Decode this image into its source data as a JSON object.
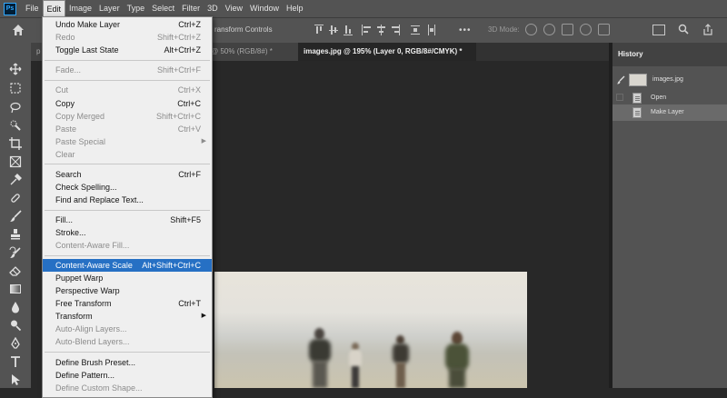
{
  "app": {
    "logo": "Ps",
    "menubar": [
      "File",
      "Edit",
      "Image",
      "Layer",
      "Type",
      "Select",
      "Filter",
      "3D",
      "View",
      "Window",
      "Help"
    ],
    "active_menu": "Edit"
  },
  "options_bar": {
    "transform_controls": "ransform Controls",
    "mode_3d": "3D Mode:"
  },
  "tabs": [
    {
      "label": "p",
      "label_visible": "g @ 50% (RGB/8#) *"
    },
    {
      "label": "images.jpg @ 195% (Layer 0, RGB/8#/CMYK) *"
    }
  ],
  "history": {
    "title": "History",
    "snapshot": "images.jpg",
    "items": [
      {
        "label": "Open"
      },
      {
        "label": "Make Layer",
        "selected": true
      }
    ]
  },
  "edit_menu": {
    "items": [
      {
        "label": "Undo Make Layer",
        "shortcut": "Ctrl+Z"
      },
      {
        "label": "Redo",
        "shortcut": "Shift+Ctrl+Z",
        "disabled": true
      },
      {
        "label": "Toggle Last State",
        "shortcut": "Alt+Ctrl+Z"
      },
      {
        "label": "Fade...",
        "shortcut": "Shift+Ctrl+F",
        "disabled": true
      },
      {
        "label": "Cut",
        "shortcut": "Ctrl+X",
        "disabled": true
      },
      {
        "label": "Copy",
        "shortcut": "Ctrl+C"
      },
      {
        "label": "Copy Merged",
        "shortcut": "Shift+Ctrl+C",
        "disabled": true
      },
      {
        "label": "Paste",
        "shortcut": "Ctrl+V",
        "disabled": true
      },
      {
        "label": "Paste Special",
        "shortcut": "",
        "disabled": true,
        "submenu": true
      },
      {
        "label": "Clear",
        "shortcut": "",
        "disabled": true
      },
      {
        "label": "Search",
        "shortcut": "Ctrl+F"
      },
      {
        "label": "Check Spelling...",
        "shortcut": ""
      },
      {
        "label": "Find and Replace Text...",
        "shortcut": ""
      },
      {
        "label": "Fill...",
        "shortcut": "Shift+F5"
      },
      {
        "label": "Stroke...",
        "shortcut": ""
      },
      {
        "label": "Content-Aware Fill...",
        "shortcut": "",
        "disabled": true
      },
      {
        "label": "Content-Aware Scale",
        "shortcut": "Alt+Shift+Ctrl+C",
        "highlighted": true
      },
      {
        "label": "Puppet Warp",
        "shortcut": ""
      },
      {
        "label": "Perspective Warp",
        "shortcut": ""
      },
      {
        "label": "Free Transform",
        "shortcut": "Ctrl+T"
      },
      {
        "label": "Transform",
        "shortcut": "",
        "submenu": true
      },
      {
        "label": "Auto-Align Layers...",
        "shortcut": "",
        "disabled": true
      },
      {
        "label": "Auto-Blend Layers...",
        "shortcut": "",
        "disabled": true
      },
      {
        "label": "Define Brush Preset...",
        "shortcut": ""
      },
      {
        "label": "Define Pattern...",
        "shortcut": ""
      },
      {
        "label": "Define Custom Shape...",
        "shortcut": "",
        "disabled": true
      }
    ]
  },
  "colors": {
    "highlight": "#2670c4",
    "ui_dark": "#282828",
    "ui_mid": "#535353"
  }
}
